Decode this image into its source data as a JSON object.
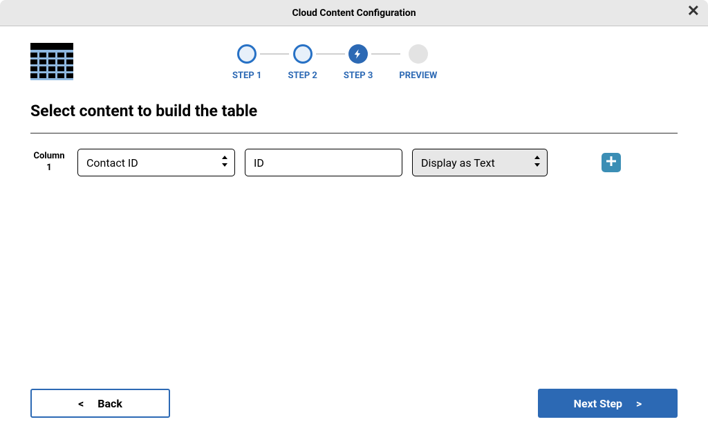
{
  "window": {
    "title": "Cloud Content Configuration"
  },
  "stepper": {
    "steps": [
      {
        "label": "STEP 1",
        "state": "outline"
      },
      {
        "label": "STEP 2",
        "state": "outline"
      },
      {
        "label": "STEP 3",
        "state": "filled"
      },
      {
        "label": "PREVIEW",
        "state": "disabled"
      }
    ]
  },
  "heading": "Select content to build the table",
  "column_row": {
    "label_prefix": "Column",
    "number": "1",
    "field_select": "Contact ID",
    "alias_input": "ID",
    "display_select": "Display as Text"
  },
  "buttons": {
    "back_symbol": "<",
    "back_label": "Back",
    "next_label": "Next Step",
    "next_symbol": ">"
  },
  "colors": {
    "primary": "#2c69b4",
    "accent": "#3b8eb5"
  }
}
